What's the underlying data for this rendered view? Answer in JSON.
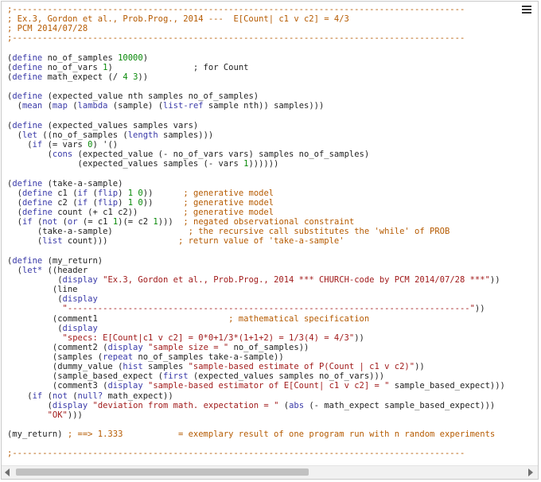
{
  "lines": [
    [
      [
        "cm",
        ";------------------------------------------------------------------------------------------"
      ]
    ],
    [
      [
        "cm",
        "; Ex.3, Gordon et al., Prob.Prog., 2014 ---  E[Count| c1 v c2] = 4/3"
      ]
    ],
    [
      [
        "cm",
        "; PCM 2014/07/28"
      ]
    ],
    [
      [
        "cm",
        ";------------------------------------------------------------------------------------------"
      ]
    ],
    [],
    [
      [
        "",
        "("
      ],
      [
        "kw",
        "define"
      ],
      [
        "",
        " no_of_samples "
      ],
      [
        "num",
        "10000"
      ],
      [
        "",
        ")"
      ]
    ],
    [
      [
        "",
        "("
      ],
      [
        "kw",
        "define"
      ],
      [
        "",
        " no_of_vars "
      ],
      [
        "num",
        "1"
      ],
      [
        "",
        ")                ; for Count"
      ]
    ],
    [
      [
        "",
        "("
      ],
      [
        "kw",
        "define"
      ],
      [
        "",
        " math_expect (/ "
      ],
      [
        "num",
        "4 3"
      ],
      [
        "",
        "))"
      ]
    ],
    [],
    [
      [
        "",
        "("
      ],
      [
        "kw",
        "define"
      ],
      [
        "",
        " (expected_value nth samples no_of_samples)"
      ]
    ],
    [
      [
        "",
        "  ("
      ],
      [
        "kw",
        "mean"
      ],
      [
        "",
        " ("
      ],
      [
        "kw",
        "map"
      ],
      [
        "",
        " ("
      ],
      [
        "kw",
        "lambda"
      ],
      [
        "",
        " (sample) ("
      ],
      [
        "kw",
        "list-ref"
      ],
      [
        "",
        " sample nth)) samples)))"
      ]
    ],
    [],
    [
      [
        "",
        "("
      ],
      [
        "kw",
        "define"
      ],
      [
        "",
        " (expected_values samples vars)"
      ]
    ],
    [
      [
        "",
        "  ("
      ],
      [
        "kw",
        "let"
      ],
      [
        "",
        " ((no_of_samples ("
      ],
      [
        "kw",
        "length"
      ],
      [
        "",
        " samples)))"
      ]
    ],
    [
      [
        "",
        "    ("
      ],
      [
        "kw",
        "if"
      ],
      [
        "",
        " (= vars "
      ],
      [
        "num",
        "0"
      ],
      [
        "",
        ") '()"
      ]
    ],
    [
      [
        "",
        "        ("
      ],
      [
        "kw",
        "cons"
      ],
      [
        "",
        " (expected_value (- no_of_vars vars) samples no_of_samples)"
      ]
    ],
    [
      [
        "",
        "              (expected_values samples (- vars "
      ],
      [
        "num",
        "1"
      ],
      [
        "",
        "))))))"
      ]
    ],
    [],
    [
      [
        "",
        "("
      ],
      [
        "kw",
        "define"
      ],
      [
        "",
        " (take-a-sample)"
      ]
    ],
    [
      [
        "",
        "  ("
      ],
      [
        "kw",
        "define"
      ],
      [
        "",
        " c1 ("
      ],
      [
        "kw",
        "if"
      ],
      [
        "",
        " ("
      ],
      [
        "kw",
        "flip"
      ],
      [
        "",
        ") "
      ],
      [
        "num",
        "1 0"
      ],
      [
        "",
        "))      "
      ],
      [
        "cm",
        "; generative model"
      ]
    ],
    [
      [
        "",
        "  ("
      ],
      [
        "kw",
        "define"
      ],
      [
        "",
        " c2 ("
      ],
      [
        "kw",
        "if"
      ],
      [
        "",
        " ("
      ],
      [
        "kw",
        "flip"
      ],
      [
        "",
        ") "
      ],
      [
        "num",
        "1 0"
      ],
      [
        "",
        "))      "
      ],
      [
        "cm",
        "; generative model"
      ]
    ],
    [
      [
        "",
        "  ("
      ],
      [
        "kw",
        "define"
      ],
      [
        "",
        " count (+ c1 c2))         "
      ],
      [
        "cm",
        "; generative model"
      ]
    ],
    [
      [
        "",
        "  ("
      ],
      [
        "kw",
        "if"
      ],
      [
        "",
        " ("
      ],
      [
        "kw",
        "not"
      ],
      [
        "",
        " ("
      ],
      [
        "kw",
        "or"
      ],
      [
        "",
        " (= c1 "
      ],
      [
        "num",
        "1"
      ],
      [
        "",
        ")(= c2 "
      ],
      [
        "num",
        "1"
      ],
      [
        "",
        ")))  "
      ],
      [
        "cm",
        "; negated observational constraint"
      ]
    ],
    [
      [
        "",
        "      (take-a-sample)               "
      ],
      [
        "cm",
        "; the recursive call substitutes the 'while' of PROB"
      ]
    ],
    [
      [
        "",
        "      ("
      ],
      [
        "kw",
        "list"
      ],
      [
        "",
        " count)))              "
      ],
      [
        "cm",
        "; return value of 'take-a-sample'"
      ]
    ],
    [],
    [
      [
        "",
        "("
      ],
      [
        "kw",
        "define"
      ],
      [
        "",
        " (my_return)"
      ]
    ],
    [
      [
        "",
        "  ("
      ],
      [
        "kw",
        "let*"
      ],
      [
        "",
        " ((header"
      ]
    ],
    [
      [
        "",
        "          ("
      ],
      [
        "kw",
        "display"
      ],
      [
        "",
        " "
      ],
      [
        "str",
        "\"Ex.3, Gordon et al., Prob.Prog., 2014 *** CHURCH-code by PCM 2014/07/28 ***\""
      ],
      [
        "",
        "))"
      ]
    ],
    [
      [
        "",
        "         (line"
      ]
    ],
    [
      [
        "",
        "          ("
      ],
      [
        "kw",
        "display"
      ]
    ],
    [
      [
        "",
        "           "
      ],
      [
        "str",
        "\"--------------------------------------------------------------------------------\""
      ],
      [
        "",
        "))"
      ]
    ],
    [
      [
        "",
        "         (comment1                          "
      ],
      [
        "cm",
        "; mathematical specification"
      ]
    ],
    [
      [
        "",
        "          ("
      ],
      [
        "kw",
        "display"
      ]
    ],
    [
      [
        "",
        "           "
      ],
      [
        "str",
        "\"specs: E[Count|c1 v c2] = 0*0+1/3*(1+1+2) = 1/3(4) = 4/3\""
      ],
      [
        "",
        "))"
      ]
    ],
    [
      [
        "",
        "         (comment2 ("
      ],
      [
        "kw",
        "display"
      ],
      [
        "",
        " "
      ],
      [
        "str",
        "\"sample size = \""
      ],
      [
        "",
        " no_of_samples))"
      ]
    ],
    [
      [
        "",
        "         (samples ("
      ],
      [
        "kw",
        "repeat"
      ],
      [
        "",
        " no_of_samples take-a-sample))"
      ]
    ],
    [
      [
        "",
        "         (dummy_value ("
      ],
      [
        "kw",
        "hist"
      ],
      [
        "",
        " samples "
      ],
      [
        "str",
        "\"sample-based estimate of P(Count | c1 v c2)\""
      ],
      [
        "",
        "))"
      ]
    ],
    [
      [
        "",
        "         (sample_based_expect ("
      ],
      [
        "kw",
        "first"
      ],
      [
        "",
        " (expected_values samples no_of_vars)))"
      ]
    ],
    [
      [
        "",
        "         (comment3 ("
      ],
      [
        "kw",
        "display"
      ],
      [
        "",
        " "
      ],
      [
        "str",
        "\"sample-based estimator of E[Count| c1 v c2] = \""
      ],
      [
        "",
        " sample_based_expect)))"
      ]
    ],
    [
      [
        "",
        "    ("
      ],
      [
        "kw",
        "if"
      ],
      [
        "",
        " ("
      ],
      [
        "kw",
        "not"
      ],
      [
        "",
        " ("
      ],
      [
        "kw",
        "null?"
      ],
      [
        "",
        " math_expect))"
      ]
    ],
    [
      [
        "",
        "        ("
      ],
      [
        "kw",
        "display"
      ],
      [
        "",
        " "
      ],
      [
        "str",
        "\"deviation from math. expectation = \""
      ],
      [
        "",
        " ("
      ],
      [
        "kw",
        "abs"
      ],
      [
        "",
        " (- math_expect sample_based_expect)))"
      ]
    ],
    [
      [
        "",
        "        "
      ],
      [
        "str",
        "\"OK\""
      ],
      [
        "",
        ")))"
      ]
    ],
    [],
    [
      [
        "",
        "(my_return) "
      ],
      [
        "cm",
        "; ==> 1.333"
      ],
      [
        "",
        "           "
      ],
      [
        "cm",
        "= exemplary result of one program run with n random experiments"
      ]
    ],
    [],
    [
      [
        "cm",
        ";------------------------------------------------------------------------------------------"
      ]
    ]
  ],
  "icons": {
    "menu": "hamburger-menu-icon",
    "scroll_left": "scroll-left-arrow-icon",
    "scroll_right": "scroll-right-arrow-icon"
  }
}
